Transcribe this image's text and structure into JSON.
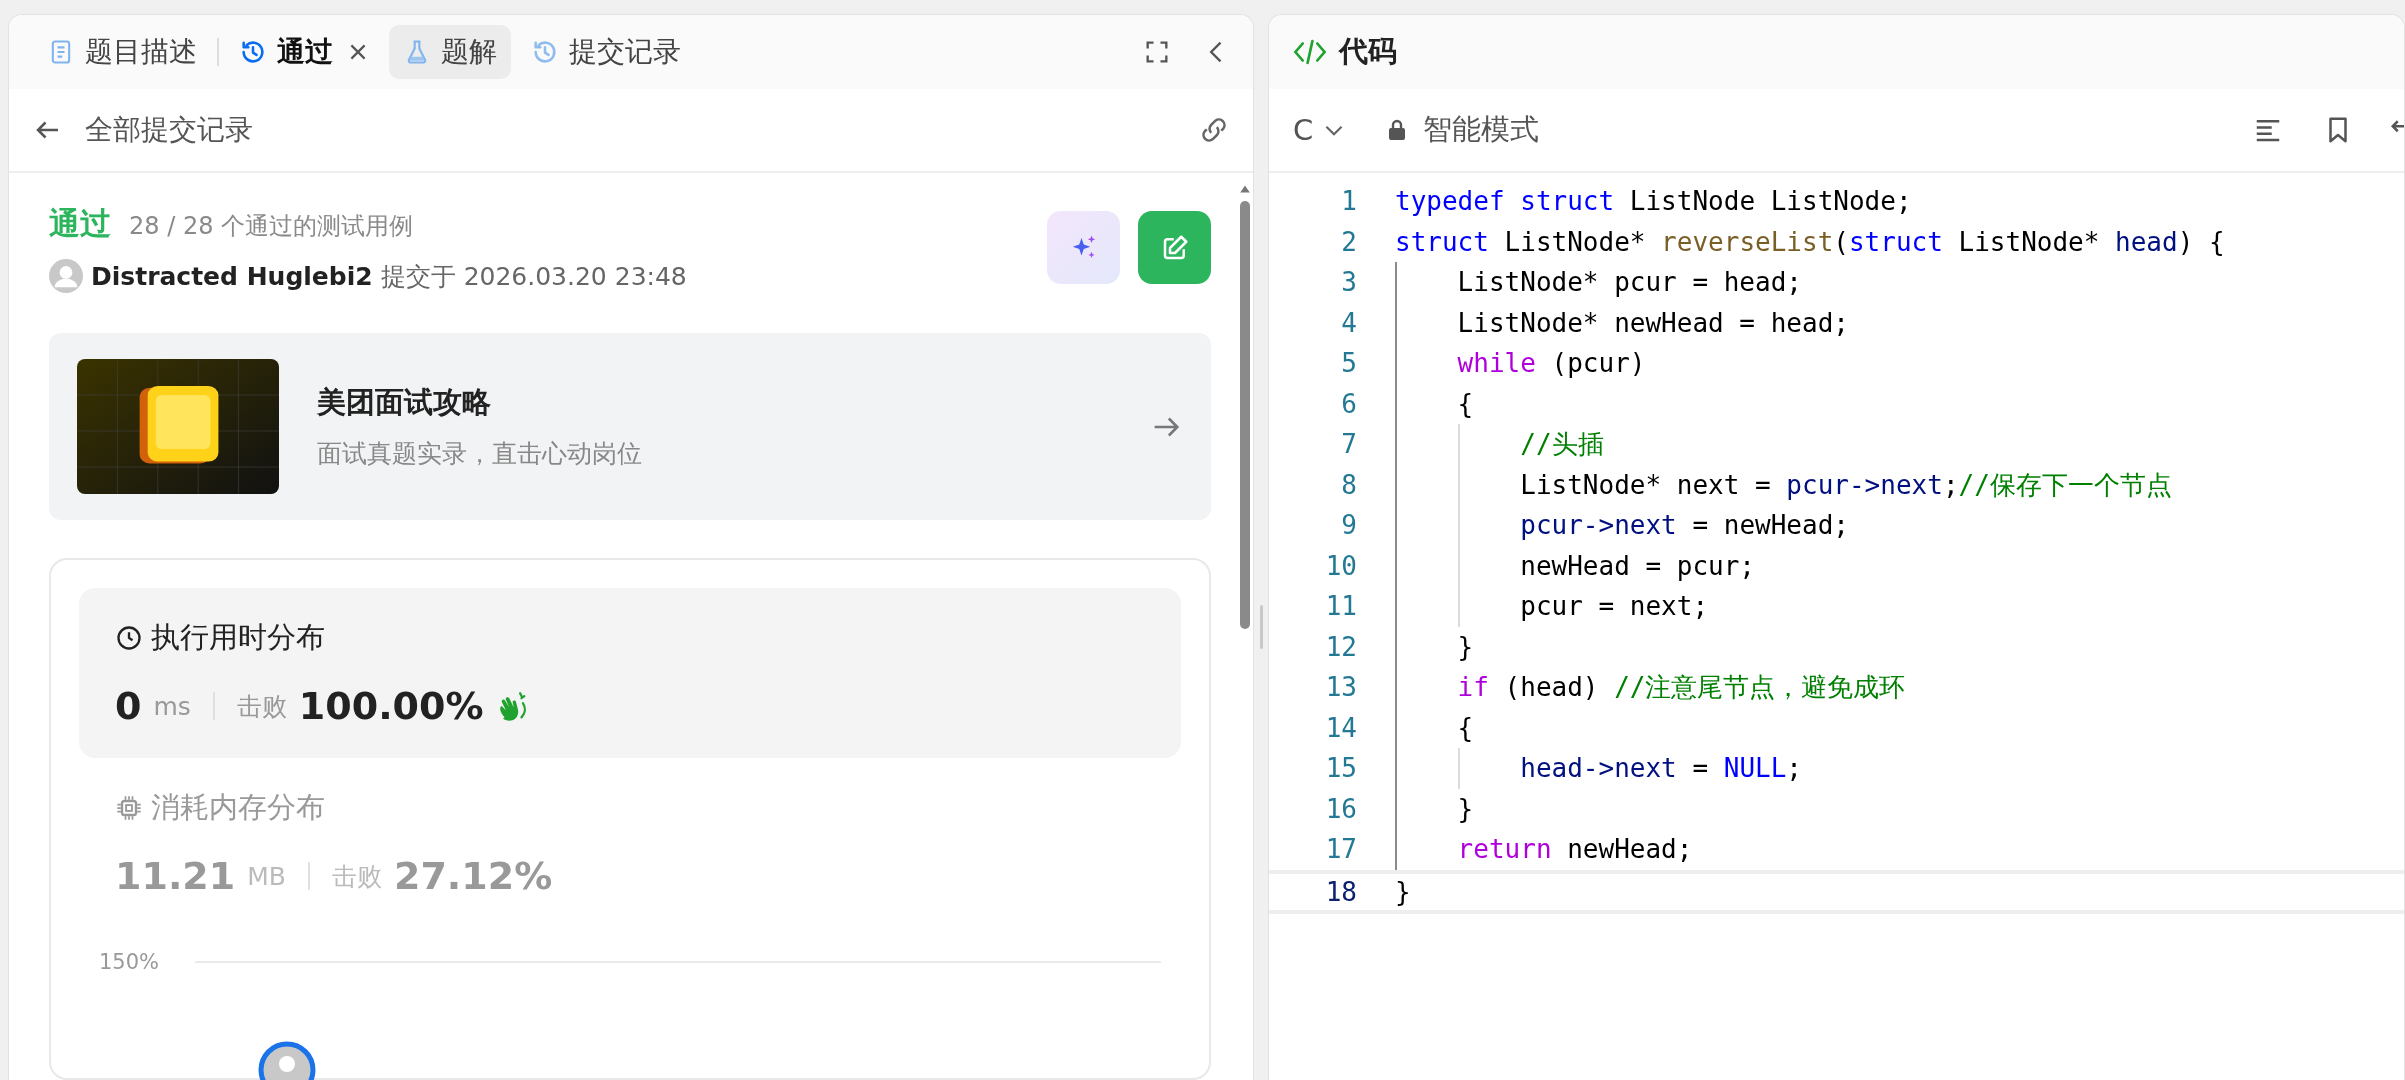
{
  "left_panel": {
    "tabs": [
      {
        "label": "题目描述",
        "kind": "document",
        "selected": false,
        "highlighted": false,
        "closable": false
      },
      {
        "label": "通过",
        "kind": "history",
        "selected": true,
        "highlighted": false,
        "closable": true
      },
      {
        "label": "题解",
        "kind": "flask",
        "selected": false,
        "highlighted": true,
        "closable": false
      },
      {
        "label": "提交记录",
        "kind": "history",
        "selected": false,
        "highlighted": false,
        "closable": false
      }
    ],
    "nav": {
      "title": "全部提交记录"
    },
    "submission": {
      "status": "通过",
      "cases": "28 / 28 个通过的测试用例",
      "user": "Distracted Huglebi2",
      "submitted": "提交于 2026.03.20 23:48"
    },
    "promo": {
      "title": "美团面试攻略",
      "subtitle": "面试真题实录，直击心动岗位"
    },
    "stats": [
      {
        "kind": "runtime",
        "title": "执行用时分布",
        "value": "0",
        "unit": "ms",
        "beat_label": "击败",
        "beat": "100.00%",
        "selected": true
      },
      {
        "kind": "memory",
        "title": "消耗内存分布",
        "value": "11.21",
        "unit": "MB",
        "beat_label": "击败",
        "beat": "27.12%",
        "selected": false
      }
    ],
    "chart_axis_label": "150%"
  },
  "right_panel": {
    "title": "代码",
    "language": "C",
    "mode": "智能模式",
    "lines": [
      {
        "number": "1",
        "current": false,
        "tokens": [
          {
            "text": "typedef",
            "kind": "keyword"
          },
          {
            "text": " struct",
            "kind": "keyword"
          },
          {
            "text": " ListNode ListNode;",
            "kind": "plain"
          }
        ]
      },
      {
        "number": "2",
        "current": false,
        "tokens": [
          {
            "text": "struct",
            "kind": "keyword"
          },
          {
            "text": " ListNode* ",
            "kind": "plain"
          },
          {
            "text": "reverseList",
            "kind": "function"
          },
          {
            "text": "(",
            "kind": "plain"
          },
          {
            "text": "struct",
            "kind": "keyword"
          },
          {
            "text": " ListNode* ",
            "kind": "plain"
          },
          {
            "text": "head",
            "kind": "variable"
          },
          {
            "text": ") {",
            "kind": "plain"
          }
        ]
      },
      {
        "number": "3",
        "current": false,
        "tokens": [
          {
            "text": "    ListNode* pcur = head;",
            "kind": "plain"
          }
        ]
      },
      {
        "number": "4",
        "current": false,
        "tokens": [
          {
            "text": "    ListNode* newHead = head;",
            "kind": "plain"
          }
        ]
      },
      {
        "number": "5",
        "current": false,
        "tokens": [
          {
            "text": "    while",
            "kind": "control"
          },
          {
            "text": " (pcur)",
            "kind": "plain"
          }
        ]
      },
      {
        "number": "6",
        "current": false,
        "tokens": [
          {
            "text": "    {",
            "kind": "plain"
          }
        ]
      },
      {
        "number": "7",
        "current": false,
        "tokens": [
          {
            "text": "        //头插",
            "kind": "comment"
          }
        ]
      },
      {
        "number": "8",
        "current": false,
        "tokens": [
          {
            "text": "        ListNode* next = ",
            "kind": "plain"
          },
          {
            "text": "pcur->next",
            "kind": "variable"
          },
          {
            "text": ";",
            "kind": "plain"
          },
          {
            "text": "//保存下一个节点",
            "kind": "comment"
          }
        ]
      },
      {
        "number": "9",
        "current": false,
        "tokens": [
          {
            "text": "        pcur->next",
            "kind": "variable"
          },
          {
            "text": " = newHead;",
            "kind": "plain"
          }
        ]
      },
      {
        "number": "10",
        "current": false,
        "tokens": [
          {
            "text": "        newHead = pcur;",
            "kind": "plain"
          }
        ]
      },
      {
        "number": "11",
        "current": false,
        "tokens": [
          {
            "text": "        pcur = next;",
            "kind": "plain"
          }
        ]
      },
      {
        "number": "12",
        "current": false,
        "tokens": [
          {
            "text": "    }",
            "kind": "plain"
          }
        ]
      },
      {
        "number": "13",
        "current": false,
        "tokens": [
          {
            "text": "    if",
            "kind": "control"
          },
          {
            "text": " (head) ",
            "kind": "plain"
          },
          {
            "text": "//注意尾节点，避免成环",
            "kind": "comment"
          }
        ]
      },
      {
        "number": "14",
        "current": false,
        "tokens": [
          {
            "text": "    {",
            "kind": "plain"
          }
        ]
      },
      {
        "number": "15",
        "current": false,
        "tokens": [
          {
            "text": "        head->next",
            "kind": "variable"
          },
          {
            "text": " = ",
            "kind": "plain"
          },
          {
            "text": "NULL",
            "kind": "keyword"
          },
          {
            "text": ";",
            "kind": "plain"
          }
        ]
      },
      {
        "number": "16",
        "current": false,
        "tokens": [
          {
            "text": "    }",
            "kind": "plain"
          }
        ]
      },
      {
        "number": "17",
        "current": false,
        "tokens": [
          {
            "text": "    return",
            "kind": "control"
          },
          {
            "text": " newHead;",
            "kind": "plain"
          }
        ]
      },
      {
        "number": "18",
        "current": true,
        "tokens": [
          {
            "text": "}",
            "kind": "plain"
          }
        ]
      }
    ]
  }
}
